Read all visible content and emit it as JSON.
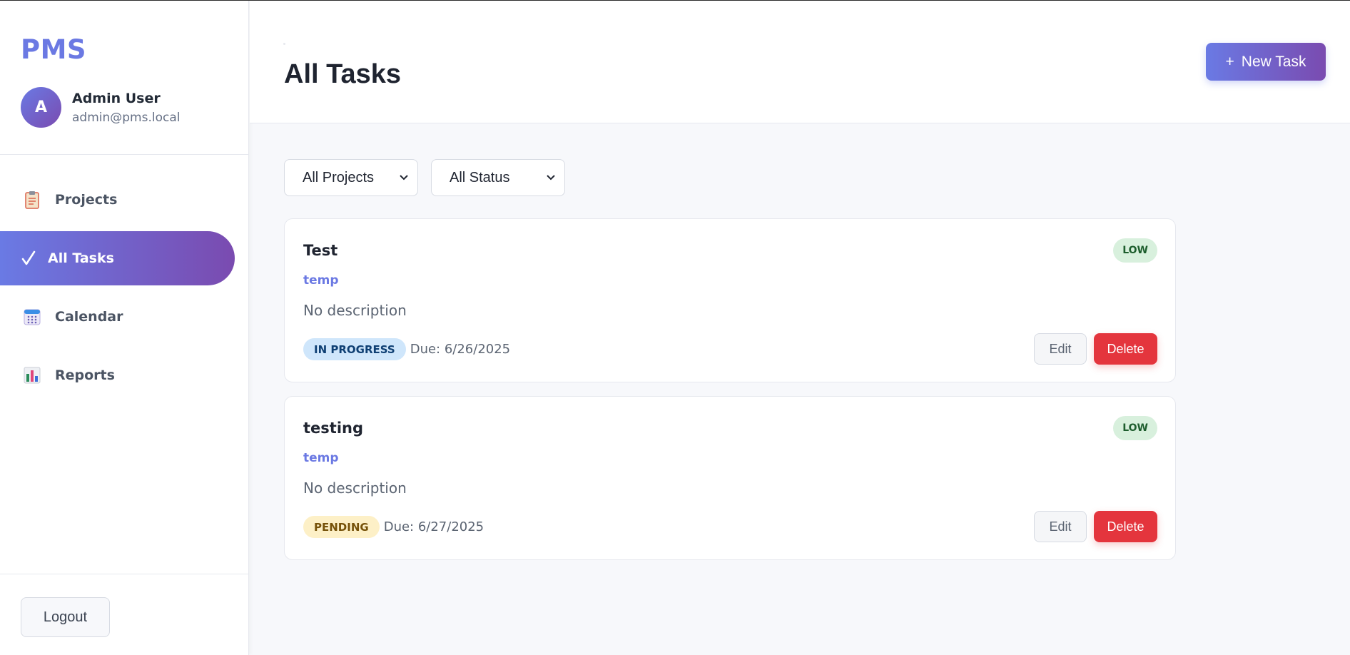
{
  "app": {
    "brand": "PMS"
  },
  "user": {
    "initial": "A",
    "name": "Admin User",
    "email": "admin@pms.local"
  },
  "sidebar": {
    "items": [
      {
        "label": "Projects",
        "icon": "clipboard-icon",
        "active": false
      },
      {
        "label": "All Tasks",
        "icon": "check-icon",
        "active": true
      },
      {
        "label": "Calendar",
        "icon": "calendar-icon",
        "active": false
      },
      {
        "label": "Reports",
        "icon": "bar-chart-icon",
        "active": false
      }
    ],
    "logout_label": "Logout"
  },
  "header": {
    "title": "All Tasks",
    "new_task_label": "New Task",
    "new_task_icon": "+"
  },
  "filters": {
    "project": {
      "selected": "All Projects"
    },
    "status": {
      "selected": "All Status"
    }
  },
  "tasks": [
    {
      "title": "Test",
      "priority": "LOW",
      "project": "temp",
      "description": "No description",
      "status": "IN PROGRESS",
      "due": "Due: 6/26/2025",
      "edit_label": "Edit",
      "delete_label": "Delete"
    },
    {
      "title": "testing",
      "priority": "LOW",
      "project": "temp",
      "description": "No description",
      "status": "PENDING",
      "due": "Due: 6/27/2025",
      "edit_label": "Edit",
      "delete_label": "Delete"
    }
  ],
  "colors": {
    "accent": "#6b79e3",
    "gradient_end": "#7a4bb0",
    "delete": "#e4353d",
    "priority_low_bg": "#d8f0dd",
    "status_in_progress_bg": "#cfe6fb",
    "status_pending_bg": "#fdf0c7"
  }
}
